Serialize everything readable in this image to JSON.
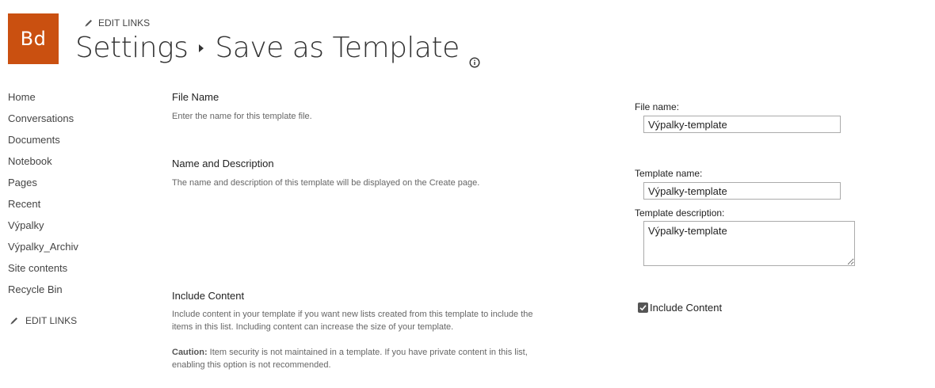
{
  "site": {
    "logo_text": "Bd",
    "logo_color": "#ca5010"
  },
  "header": {
    "edit_links": "EDIT LINKS",
    "breadcrumb_root": "Settings",
    "breadcrumb_current": "Save as Template"
  },
  "nav": {
    "items": [
      {
        "label": "Home"
      },
      {
        "label": "Conversations"
      },
      {
        "label": "Documents"
      },
      {
        "label": "Notebook"
      },
      {
        "label": "Pages"
      },
      {
        "label": "Recent"
      },
      {
        "label": "Výpalky"
      },
      {
        "label": "Výpalky_Archiv"
      },
      {
        "label": "Site contents"
      },
      {
        "label": "Recycle Bin"
      }
    ],
    "edit_links": "EDIT LINKS"
  },
  "sections": {
    "file_name": {
      "title": "File Name",
      "description": "Enter the name for this template file."
    },
    "name_description": {
      "title": "Name and Description",
      "description": "The name and description of this template will be displayed on the Create page."
    },
    "include_content": {
      "title": "Include Content",
      "description": "Include content in your template if you want new lists created from this template to include the items in this list. Including content can increase the size of your template.",
      "caution_label": "Caution:",
      "caution_text": " Item security is not maintained in a template. If you have private content in this list, enabling this option is not recommended."
    }
  },
  "form": {
    "file_name_label": "File name:",
    "file_name_value": "Výpalky-template",
    "template_name_label": "Template name:",
    "template_name_value": "Výpalky-template",
    "template_description_label": "Template description:",
    "template_description_value": "Výpalky-template",
    "include_content_label": "Include Content",
    "include_content_checked": true
  }
}
